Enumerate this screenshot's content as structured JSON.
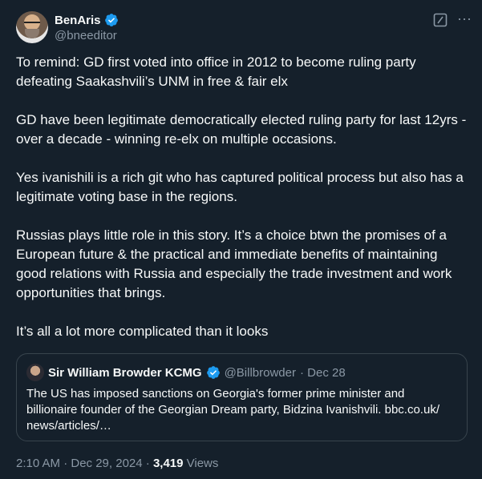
{
  "author": {
    "display_name": "BenAris",
    "handle": "@bneeditor"
  },
  "tweet": {
    "paragraphs": [
      "To remind: GD first voted into office in 2012 to become ruling party defeating Saakashvili’s UNM in free & fair elx",
      "GD have been legitimate democratically elected ruling party for last 12yrs - over a decade - winning re-elx on multiple occasions.",
      "Yes ivanishili is a rich git who has captured political process but also has a legitimate voting base in the regions.",
      "Russias plays little role in this story. It’s a choice btwn the promises of a European future & the practical and immediate benefits of maintaining good relations with Russia and especially the trade investment and work opportunities that brings.",
      "It’s all a lot more complicated than it looks"
    ]
  },
  "quote": {
    "display_name": "Sir William Browder KCMG",
    "handle": "@Billbrowder",
    "date": "· Dec 28",
    "text": "The US has imposed sanctions on Georgia's former prime minister and billionaire founder of the Georgian Dream party, Bidzina Ivanishvili. bbc.co.uk/ news/articles/…"
  },
  "meta": {
    "time": "2:10 AM · Dec 29, 2024 · ",
    "views_count": "3,419",
    "views_label": " Views"
  },
  "colors": {
    "background": "#15202b",
    "verified": "#1d9bf0"
  }
}
